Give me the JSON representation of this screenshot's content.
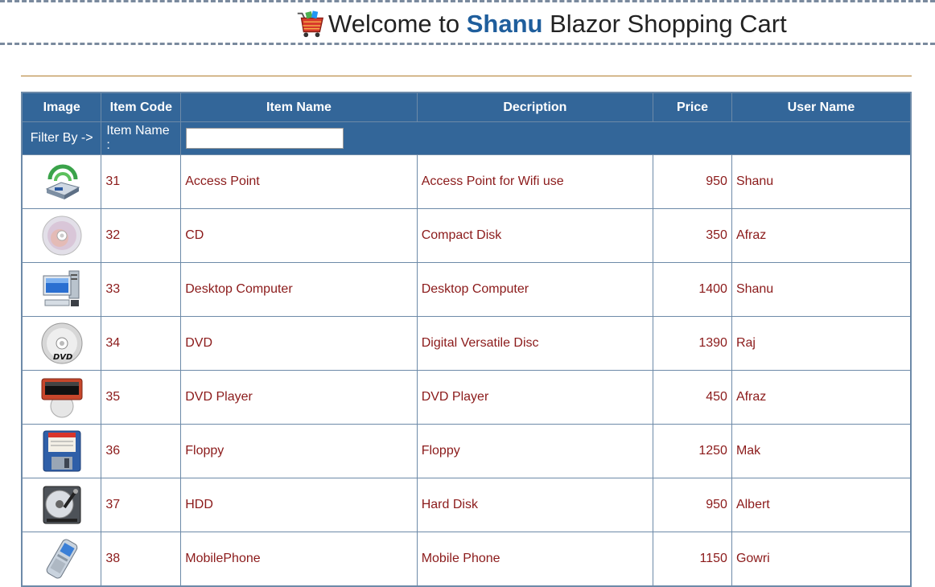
{
  "header": {
    "title_prefix": "Welcome to ",
    "brand": "Shanu",
    "title_suffix": " Blazor Shopping Cart",
    "logo_icon": "shopping-basket-icon"
  },
  "table": {
    "columns": [
      "Image",
      "Item Code",
      "Item Name",
      "Decription",
      "Price",
      "User Name"
    ],
    "filter": {
      "label": "Filter By ->",
      "field_label": "Item Name :",
      "value": "",
      "placeholder": ""
    },
    "rows": [
      {
        "image_icon": "access-point-icon",
        "code": "31",
        "name": "Access Point",
        "description": "Access Point for Wifi use",
        "price": "950",
        "user": "Shanu"
      },
      {
        "image_icon": "cd-icon",
        "code": "32",
        "name": "CD",
        "description": "Compact Disk",
        "price": "350",
        "user": "Afraz"
      },
      {
        "image_icon": "desktop-computer-icon",
        "code": "33",
        "name": "Desktop Computer",
        "description": "Desktop Computer",
        "price": "1400",
        "user": "Shanu"
      },
      {
        "image_icon": "dvd-icon",
        "code": "34",
        "name": "DVD",
        "description": "Digital Versatile Disc",
        "price": "1390",
        "user": "Raj"
      },
      {
        "image_icon": "dvd-player-icon",
        "code": "35",
        "name": "DVD Player",
        "description": "DVD Player",
        "price": "450",
        "user": "Afraz"
      },
      {
        "image_icon": "floppy-icon",
        "code": "36",
        "name": "Floppy",
        "description": "Floppy",
        "price": "1250",
        "user": "Mak"
      },
      {
        "image_icon": "hdd-icon",
        "code": "37",
        "name": "HDD",
        "description": "Hard Disk",
        "price": "950",
        "user": "Albert"
      },
      {
        "image_icon": "mobile-phone-icon",
        "code": "38",
        "name": "MobilePhone",
        "description": "Mobile Phone",
        "price": "1150",
        "user": "Gowri"
      }
    ]
  },
  "colors": {
    "header_bg": "#336699",
    "row_text": "#8b1a1a",
    "brand": "#1f5e9c",
    "border": "#6d8aa8",
    "rule": "#b07d2c"
  }
}
